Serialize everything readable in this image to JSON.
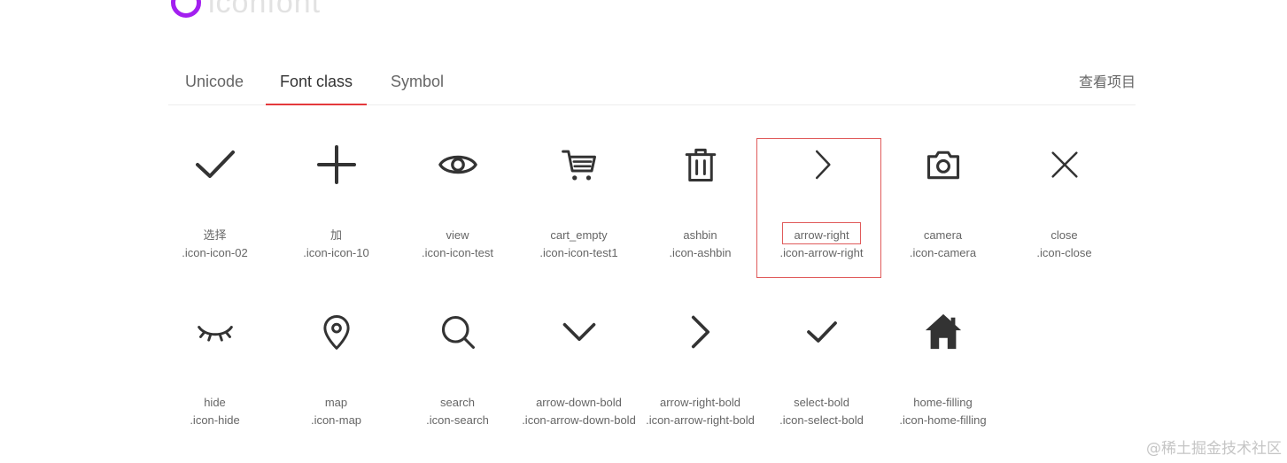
{
  "logo": {
    "text": "iconfont"
  },
  "tabs": [
    {
      "label": "Unicode"
    },
    {
      "label": "Font class"
    },
    {
      "label": "Symbol"
    }
  ],
  "project_link": "查看项目",
  "icons": [
    {
      "name": "选择",
      "class": ".icon-icon-02",
      "icon": "check-icon"
    },
    {
      "name": "加",
      "class": ".icon-icon-10",
      "icon": "plus-icon"
    },
    {
      "name": "view",
      "class": ".icon-icon-test",
      "icon": "eye-icon"
    },
    {
      "name": "cart_empty",
      "class": ".icon-icon-test1",
      "icon": "cart-icon"
    },
    {
      "name": "ashbin",
      "class": ".icon-ashbin",
      "icon": "trash-icon"
    },
    {
      "name": "arrow-right",
      "class": ".icon-arrow-right",
      "icon": "arrow-right-icon"
    },
    {
      "name": "camera",
      "class": ".icon-camera",
      "icon": "camera-icon"
    },
    {
      "name": "close",
      "class": ".icon-close",
      "icon": "close-icon"
    },
    {
      "name": "hide",
      "class": ".icon-hide",
      "icon": "eye-closed-icon"
    },
    {
      "name": "map",
      "class": ".icon-map",
      "icon": "map-pin-icon"
    },
    {
      "name": "search",
      "class": ".icon-search",
      "icon": "search-icon"
    },
    {
      "name": "arrow-down-bold",
      "class": ".icon-arrow-down-bold",
      "icon": "arrow-down-bold-icon"
    },
    {
      "name": "arrow-right-bold",
      "class": ".icon-arrow-right-bold",
      "icon": "arrow-right-bold-icon"
    },
    {
      "name": "select-bold",
      "class": ".icon-select-bold",
      "icon": "check-bold-icon"
    },
    {
      "name": "home-filling",
      "class": ".icon-home-filling",
      "icon": "home-icon"
    }
  ],
  "watermark": "@稀土掘金技术社区",
  "colors": {
    "active_tab_underline": "#e4393c",
    "highlight_box": "#e05a5a",
    "logo_accent": "#a31ff0",
    "icon_stroke": "#333333"
  }
}
